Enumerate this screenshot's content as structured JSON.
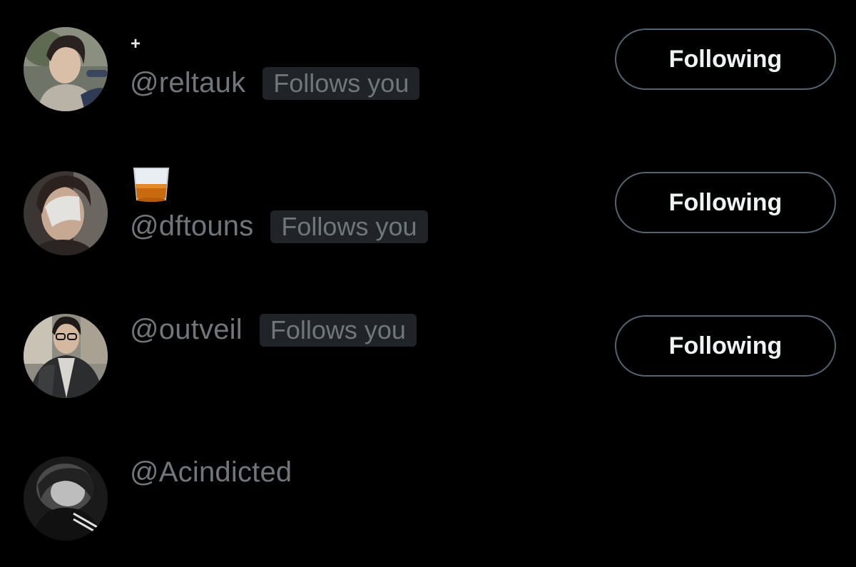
{
  "users": [
    {
      "display_name": "+",
      "handle": "@reltauk",
      "badge": "Follows you",
      "button": "Following"
    },
    {
      "display_name_icon": "whiskey-glass-emoji",
      "handle": "@dftouns",
      "badge": "Follows you",
      "button": "Following"
    },
    {
      "handle": "@outveil",
      "badge": "Follows you",
      "button": "Following"
    },
    {
      "handle": "@Acindicted"
    }
  ],
  "colors": {
    "background": "#000000",
    "handle_text": "#71767b",
    "badge_background": "#202327",
    "button_border": "#536471",
    "button_text": "#eff3f4"
  }
}
